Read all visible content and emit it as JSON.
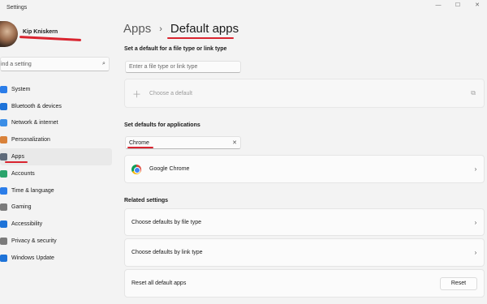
{
  "window": {
    "title": "Settings",
    "controls": [
      "minimize-icon",
      "maximize-icon",
      "close-icon"
    ]
  },
  "profile": {
    "name": "Kip Kniskern"
  },
  "sidebar": {
    "search_placeholder": "ind a setting",
    "items": [
      {
        "label": "System",
        "icon": "system-icon",
        "color": "#2b7de9"
      },
      {
        "label": "Bluetooth & devices",
        "icon": "bluetooth-icon",
        "color": "#1e73d8"
      },
      {
        "label": "Network & internet",
        "icon": "network-icon",
        "color": "#3b8ee6"
      },
      {
        "label": "Personalization",
        "icon": "brush-icon",
        "color": "#d9823a"
      },
      {
        "label": "Apps",
        "icon": "apps-icon",
        "color": "#5f6b7a",
        "active": true
      },
      {
        "label": "Accounts",
        "icon": "accounts-icon",
        "color": "#2aa36b"
      },
      {
        "label": "Time & language",
        "icon": "globe-icon",
        "color": "#2b7de9"
      },
      {
        "label": "Gaming",
        "icon": "gaming-icon",
        "color": "#7b7b7b"
      },
      {
        "label": "Accessibility",
        "icon": "accessibility-icon",
        "color": "#1e73d8"
      },
      {
        "label": "Privacy & security",
        "icon": "shield-icon",
        "color": "#7b7b7b"
      },
      {
        "label": "Windows Update",
        "icon": "update-icon",
        "color": "#1e73d8"
      }
    ]
  },
  "breadcrumb": {
    "parent": "Apps",
    "separator": "›",
    "current": "Default apps"
  },
  "file_type_section": {
    "label": "Set a default for a file type or link type",
    "input_placeholder": "Enter a file type or link type",
    "choose_default": "Choose a default"
  },
  "apps_section": {
    "label": "Set defaults for applications",
    "search_value": "Chrome",
    "result": "Google Chrome"
  },
  "related": {
    "label": "Related settings",
    "by_file_type": "Choose defaults by file type",
    "by_link_type": "Choose defaults by link type",
    "reset_label": "Reset all default apps",
    "reset_button": "Reset"
  },
  "accent": "#d9242f"
}
